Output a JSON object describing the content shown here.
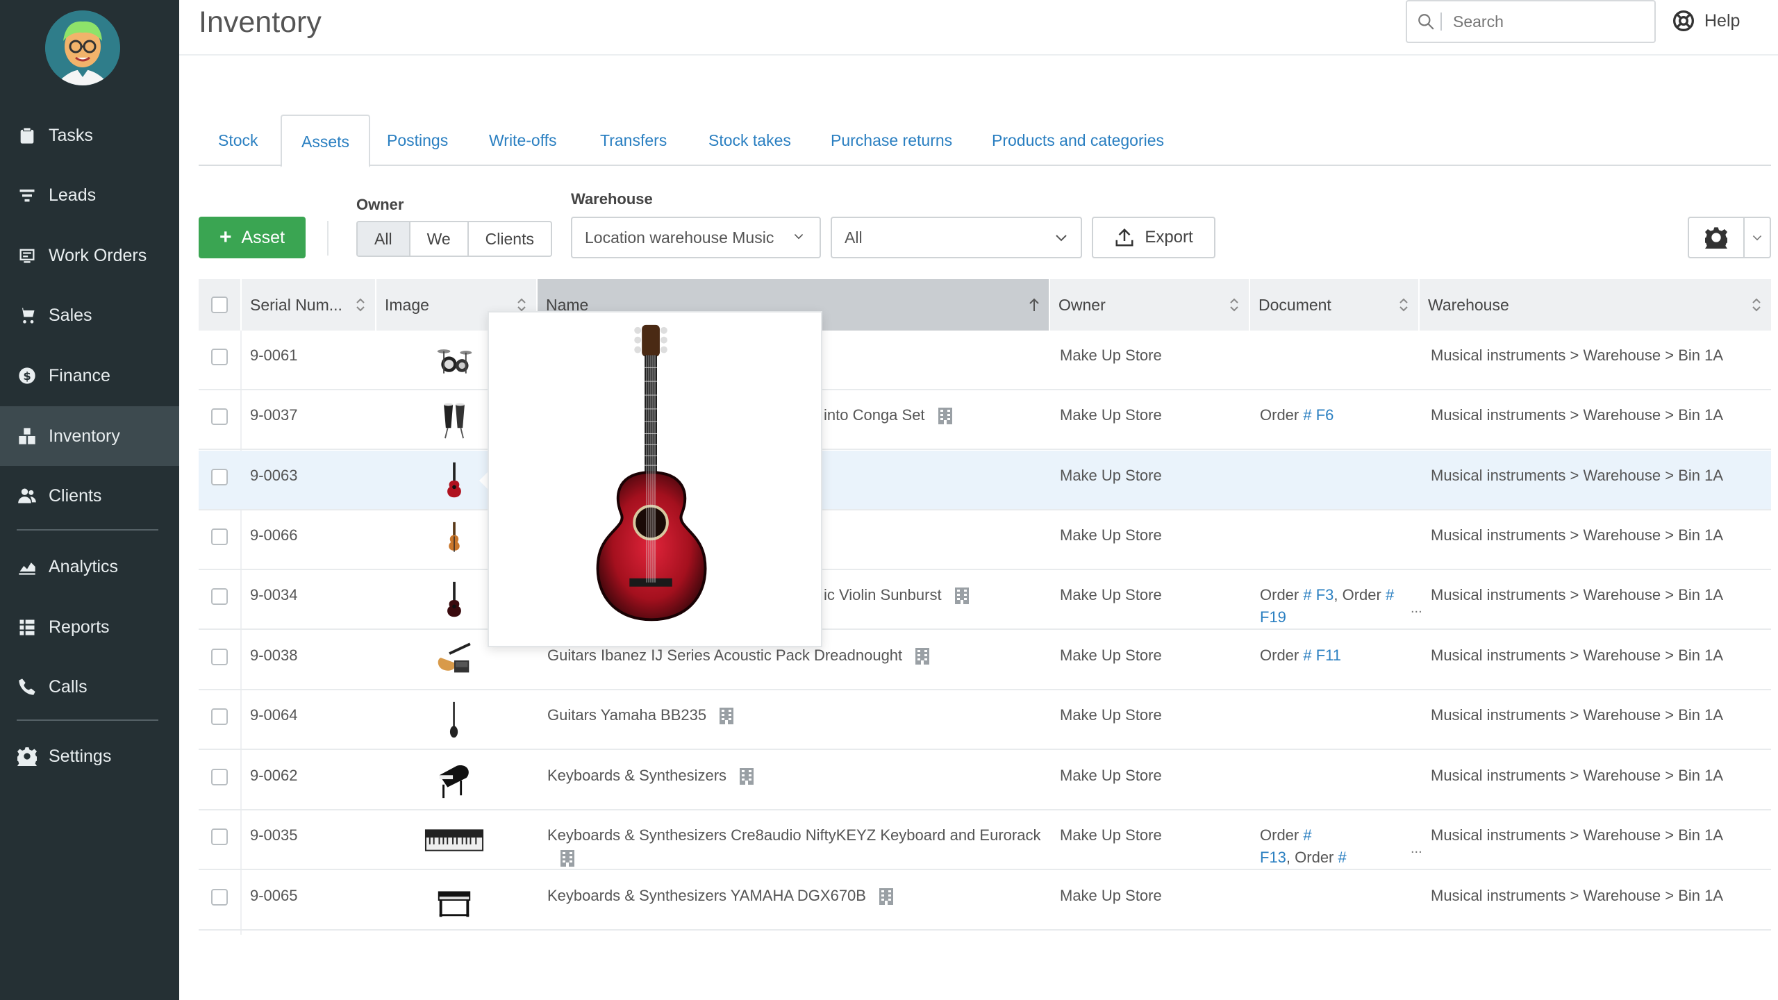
{
  "sidebar": {
    "items": [
      {
        "label": "Tasks",
        "icon": "clipboard-icon"
      },
      {
        "label": "Leads",
        "icon": "filter-icon"
      },
      {
        "label": "Work Orders",
        "icon": "work-order-icon"
      },
      {
        "label": "Sales",
        "icon": "cart-icon"
      },
      {
        "label": "Finance",
        "icon": "dollar-icon"
      },
      {
        "label": "Inventory",
        "icon": "inventory-icon",
        "active": true
      },
      {
        "label": "Clients",
        "icon": "users-icon"
      },
      {
        "label": "Analytics",
        "icon": "chart-icon"
      },
      {
        "label": "Reports",
        "icon": "reports-icon"
      },
      {
        "label": "Calls",
        "icon": "phone-icon"
      },
      {
        "label": "Settings",
        "icon": "gear-icon"
      }
    ]
  },
  "header": {
    "title": "Inventory",
    "search_placeholder": "Search",
    "help_label": "Help"
  },
  "tabs": [
    {
      "label": "Stock"
    },
    {
      "label": "Assets",
      "active": true
    },
    {
      "label": "Postings"
    },
    {
      "label": "Write-offs"
    },
    {
      "label": "Transfers"
    },
    {
      "label": "Stock takes"
    },
    {
      "label": "Purchase returns"
    },
    {
      "label": "Products and categories"
    }
  ],
  "toolbar": {
    "add_label": "Asset",
    "owner_label": "Owner",
    "owner_options": [
      "All",
      "We",
      "Clients"
    ],
    "owner_selected": "All",
    "warehouse_label": "Warehouse",
    "warehouse_value": "Location warehouse Music",
    "filter_value": "All",
    "export_label": "Export"
  },
  "table": {
    "headers": {
      "serial": "Serial Num...",
      "image": "Image",
      "name": "Name",
      "owner": "Owner",
      "document": "Document",
      "warehouse": "Warehouse"
    },
    "rows": [
      {
        "serial": "9-0061",
        "name": "",
        "owner": "Make Up Store",
        "doc1": "",
        "doc2": "",
        "warehouse": "Musical instruments > Warehouse > Bin 1A",
        "thumb": "drum-kit"
      },
      {
        "serial": "9-0037",
        "name": "into Conga Set",
        "owner": "Make Up Store",
        "doc1": "Order ",
        "doc1_link": "# F6",
        "doc2": "",
        "warehouse": "Musical instruments > Warehouse > Bin 1A",
        "thumb": "conga"
      },
      {
        "serial": "9-0063",
        "name": "",
        "owner": "Make Up Store",
        "doc1": "",
        "doc2": "",
        "warehouse": "Musical instruments > Warehouse > Bin 1A",
        "thumb": "guitar-red",
        "highlight": true
      },
      {
        "serial": "9-0066",
        "name": "",
        "owner": "Make Up Store",
        "doc1": "",
        "doc2": "",
        "warehouse": "Musical instruments > Warehouse > Bin 1A",
        "thumb": "violin"
      },
      {
        "serial": "9-0034",
        "name": "ic Violin Sunburst",
        "owner": "Make Up Store",
        "doc1": "Order ",
        "doc1_link": "# F3",
        "doc1b": ", Order ",
        "doc1b_link": "#",
        "doc2_link": "F19",
        "warehouse": "Musical instruments > Warehouse > Bin 1A",
        "thumb": "guitar-small"
      },
      {
        "serial": "9-0038",
        "name": "Guitars Ibanez IJ Series Acoustic Pack Dreadnought",
        "owner": "Make Up Store",
        "doc1": "Order ",
        "doc1_link": "# F11",
        "doc2": "",
        "warehouse": "Musical instruments > Warehouse > Bin 1A",
        "thumb": "guitar-pack"
      },
      {
        "serial": "9-0064",
        "name": "Guitars Yamaha BB235",
        "owner": "Make Up Store",
        "doc1": "",
        "doc2": "",
        "warehouse": "Musical instruments > Warehouse > Bin 1A",
        "thumb": "bass"
      },
      {
        "serial": "9-0062",
        "name": "Keyboards & Synthesizers",
        "owner": "Make Up Store",
        "doc1": "",
        "doc2": "",
        "warehouse": "Musical instruments > Warehouse > Bin 1A",
        "thumb": "grand-piano"
      },
      {
        "serial": "9-0035",
        "name": "Keyboards & Synthesizers Cre8audio NiftyKEYZ Keyboard and Eurorack",
        "owner": "Make Up Store",
        "doc1": "Order ",
        "doc1_link": "#",
        "doc2_link": "F13",
        "doc2_rest": ", Order ",
        "doc2_link2": "#",
        "warehouse": "Musical instruments > Warehouse > Bin 1A",
        "thumb": "keyboard"
      },
      {
        "serial": "9-0065",
        "name": "Keyboards & Synthesizers YAMAHA DGX670B",
        "owner": "Make Up Store",
        "doc1": "",
        "doc2": "",
        "warehouse": "Musical instruments > Warehouse > Bin 1A",
        "thumb": "digital-piano"
      }
    ]
  },
  "popover": {
    "image": "red-classical-guitar"
  },
  "colors": {
    "sidebar": "#253034",
    "accent_green": "#3aa552",
    "link": "#2a7fc1",
    "highlight": "#eaf3fb"
  }
}
